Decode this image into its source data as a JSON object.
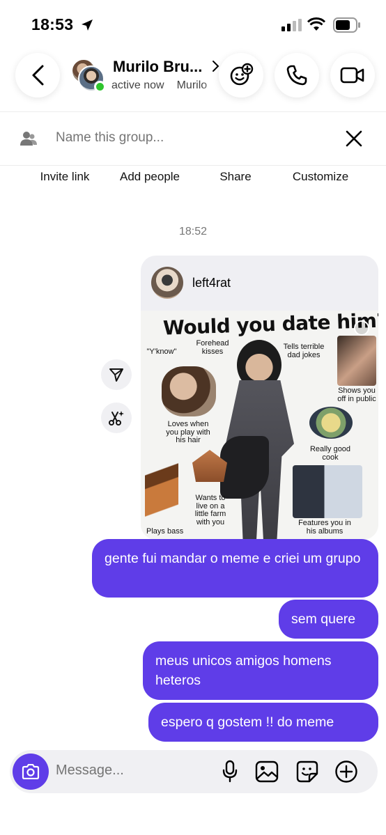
{
  "status": {
    "time": "18:53"
  },
  "header": {
    "name": "Murilo Bru...",
    "active": "active now",
    "second_member": "Murilo"
  },
  "group": {
    "name_placeholder": "Name this group..."
  },
  "actions": [
    "Invite link",
    "Add people",
    "Share",
    "Customize"
  ],
  "timestamp": "18:52",
  "shared_post": {
    "username": "left4rat",
    "meme": {
      "title": "Would you date him?",
      "labels": [
        "\"Y'know\"",
        "Forehead kisses",
        "Tells terrible dad jokes",
        "Shows you off in public",
        "Loves when you play with his hair",
        "Really good cook",
        "Wants to live on a little farm with you",
        "Plays bass",
        "Features you in his albums"
      ]
    }
  },
  "messages": [
    {
      "text": "gente fui mandar o meme e criei um grupo"
    },
    {
      "text": "sem quere"
    },
    {
      "text": "meus unicos amigos homens heteros"
    },
    {
      "text": "espero q gostem !! do meme"
    }
  ],
  "composer": {
    "placeholder": "Message..."
  },
  "colors": {
    "accent": "#5f3de8",
    "active_dot": "#2ec52e"
  }
}
